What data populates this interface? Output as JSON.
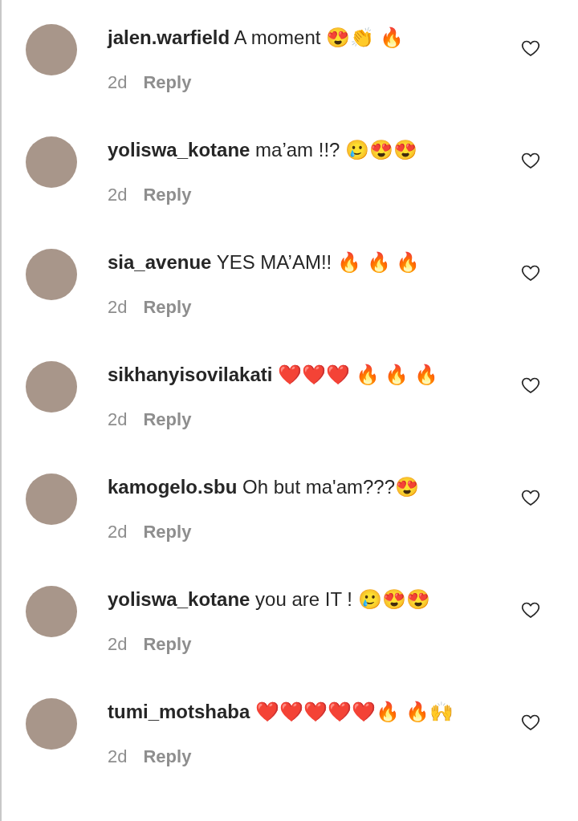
{
  "comments": [
    {
      "text": "**jalen.warfield** A moment 😍👏 🔥",
      "time": "2d",
      "reply": "Reply",
      "liked": false
    },
    {
      "text": "**yoliswa_kotane** ma’am !!? 🥲😍😍",
      "time": "2d",
      "reply": "Reply",
      "liked": false
    },
    {
      "text": "**sia_avenue** YES MA’AM!! 🔥 🔥 🔥",
      "time": "2d",
      "reply": "Reply",
      "liked": false
    },
    {
      "text": "**sikhanyisovilakati** ❤️❤️❤️ 🔥 🔥 🔥",
      "time": "2d",
      "reply": "Reply",
      "liked": false
    },
    {
      "text": "**kamogelo.sbu** Oh but ma'am???😍",
      "time": "2d",
      "reply": "Reply",
      "liked": false
    },
    {
      "text": "**yoliswa_kotane** you are IT ! 🥲😍😍",
      "time": "2d",
      "reply": "Reply",
      "liked": false
    },
    {
      "text": "**tumi_motshaba** ❤️❤️❤️❤️❤️🔥 🔥🙌",
      "time": "2d",
      "reply": "Reply",
      "liked": false
    }
  ]
}
